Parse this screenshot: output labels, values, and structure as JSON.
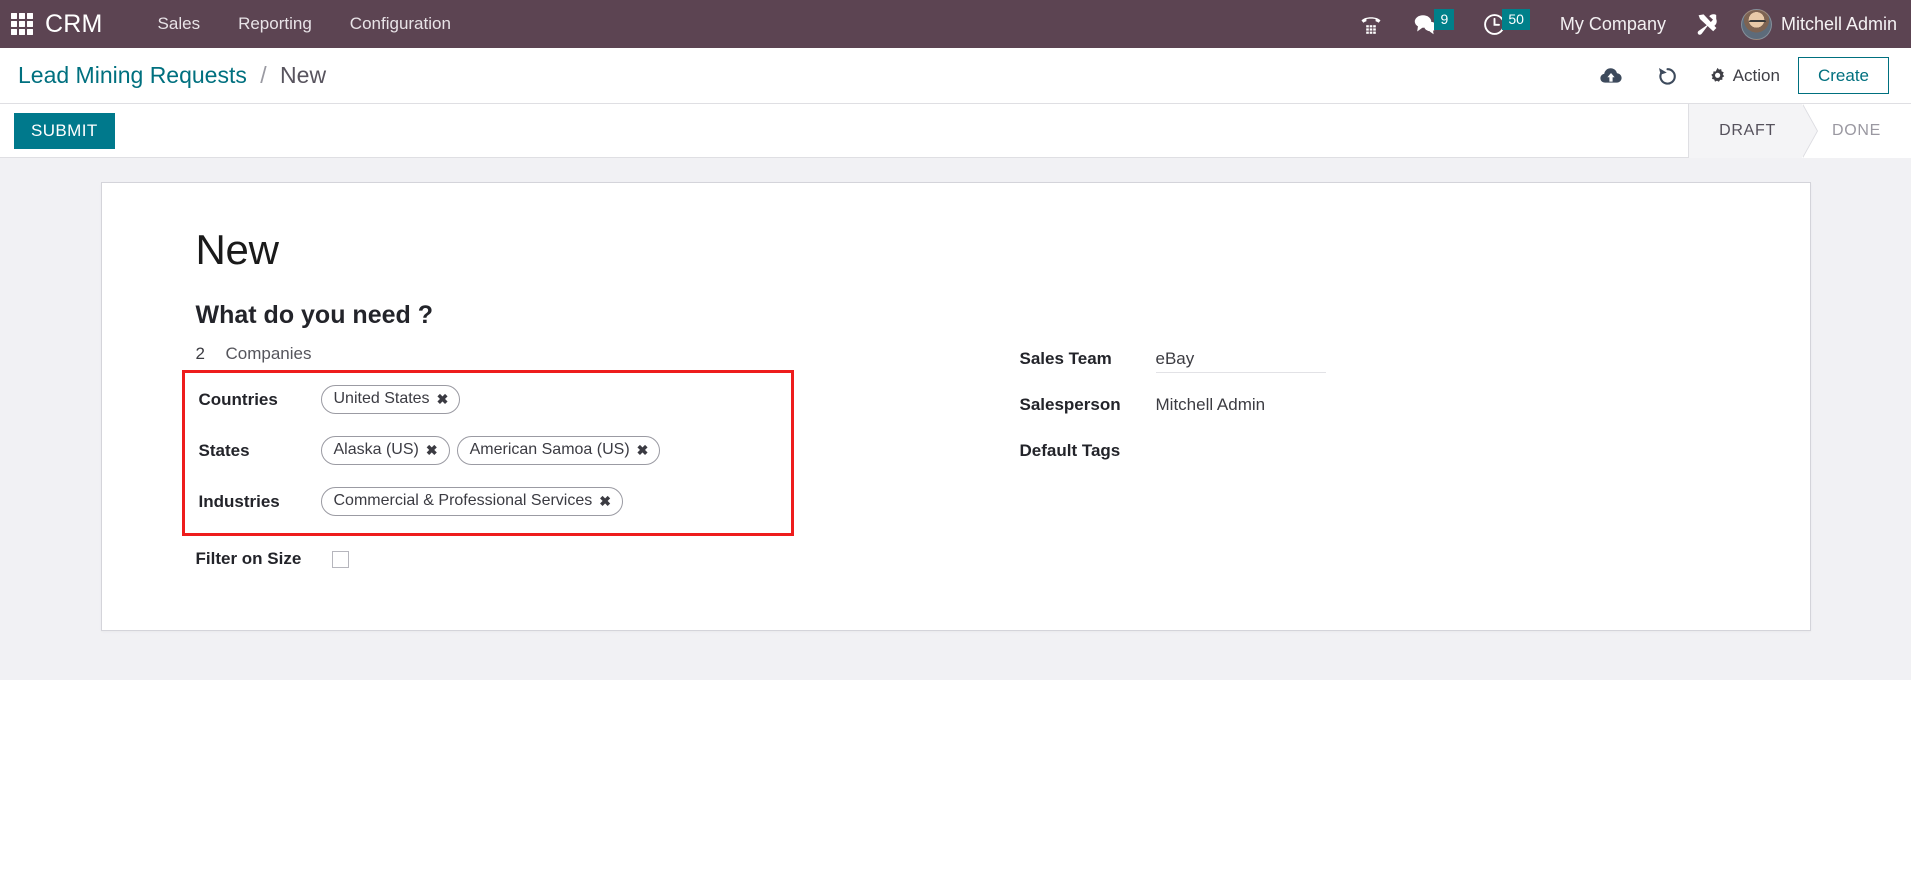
{
  "navbar": {
    "apps_icon": "apps-grid-icon",
    "brand": "CRM",
    "menu": [
      {
        "label": "Sales"
      },
      {
        "label": "Reporting"
      },
      {
        "label": "Configuration"
      }
    ],
    "phone_icon": "phone-dialpad-icon",
    "messages_icon": "chat-bubble-icon",
    "messages_count": "9",
    "activities_icon": "clock-icon",
    "activities_count": "50",
    "company": "My Company",
    "tools_icon": "wrench-screwdriver-icon",
    "avatar": "user-avatar",
    "user": "Mitchell Admin",
    "accent_badge_color": "#00808a",
    "background_color": "#5c4452"
  },
  "control_panel": {
    "breadcrumb_root": "Lead Mining Requests",
    "breadcrumb_separator": "/",
    "breadcrumb_current": "New",
    "save_icon": "cloud-upload-icon",
    "discard_icon": "undo-arrow-icon",
    "action_icon": "gear-icon",
    "action_label": "Action",
    "create_label": "Create",
    "accent_color": "#00707f"
  },
  "statusbar": {
    "submit_label": "SUBMIT",
    "steps": [
      {
        "label": "DRAFT",
        "active": true
      },
      {
        "label": "DONE",
        "active": false
      }
    ]
  },
  "form": {
    "record_title": "New",
    "section_heading": "What do you need ?",
    "count": {
      "number": "2",
      "unit": "Companies"
    },
    "left_fields": [
      {
        "label": "Countries",
        "name": "countries",
        "tags": [
          "United States"
        ]
      },
      {
        "label": "States",
        "name": "states",
        "tags": [
          "Alaska (US)",
          "American Samoa (US)"
        ]
      },
      {
        "label": "Industries",
        "name": "industries",
        "tags": [
          "Commercial & Professional Services"
        ]
      }
    ],
    "filter_on_size": {
      "label": "Filter on Size",
      "checked": false
    },
    "right_fields": [
      {
        "label": "Sales Team",
        "value": "eBay",
        "name": "sales-team"
      },
      {
        "label": "Salesperson",
        "value": "Mitchell Admin",
        "name": "salesperson"
      },
      {
        "label": "Default Tags",
        "value": "",
        "name": "default-tags"
      }
    ],
    "highlight_color": "#ee1c1c",
    "tag_remove_glyph": "✖"
  }
}
